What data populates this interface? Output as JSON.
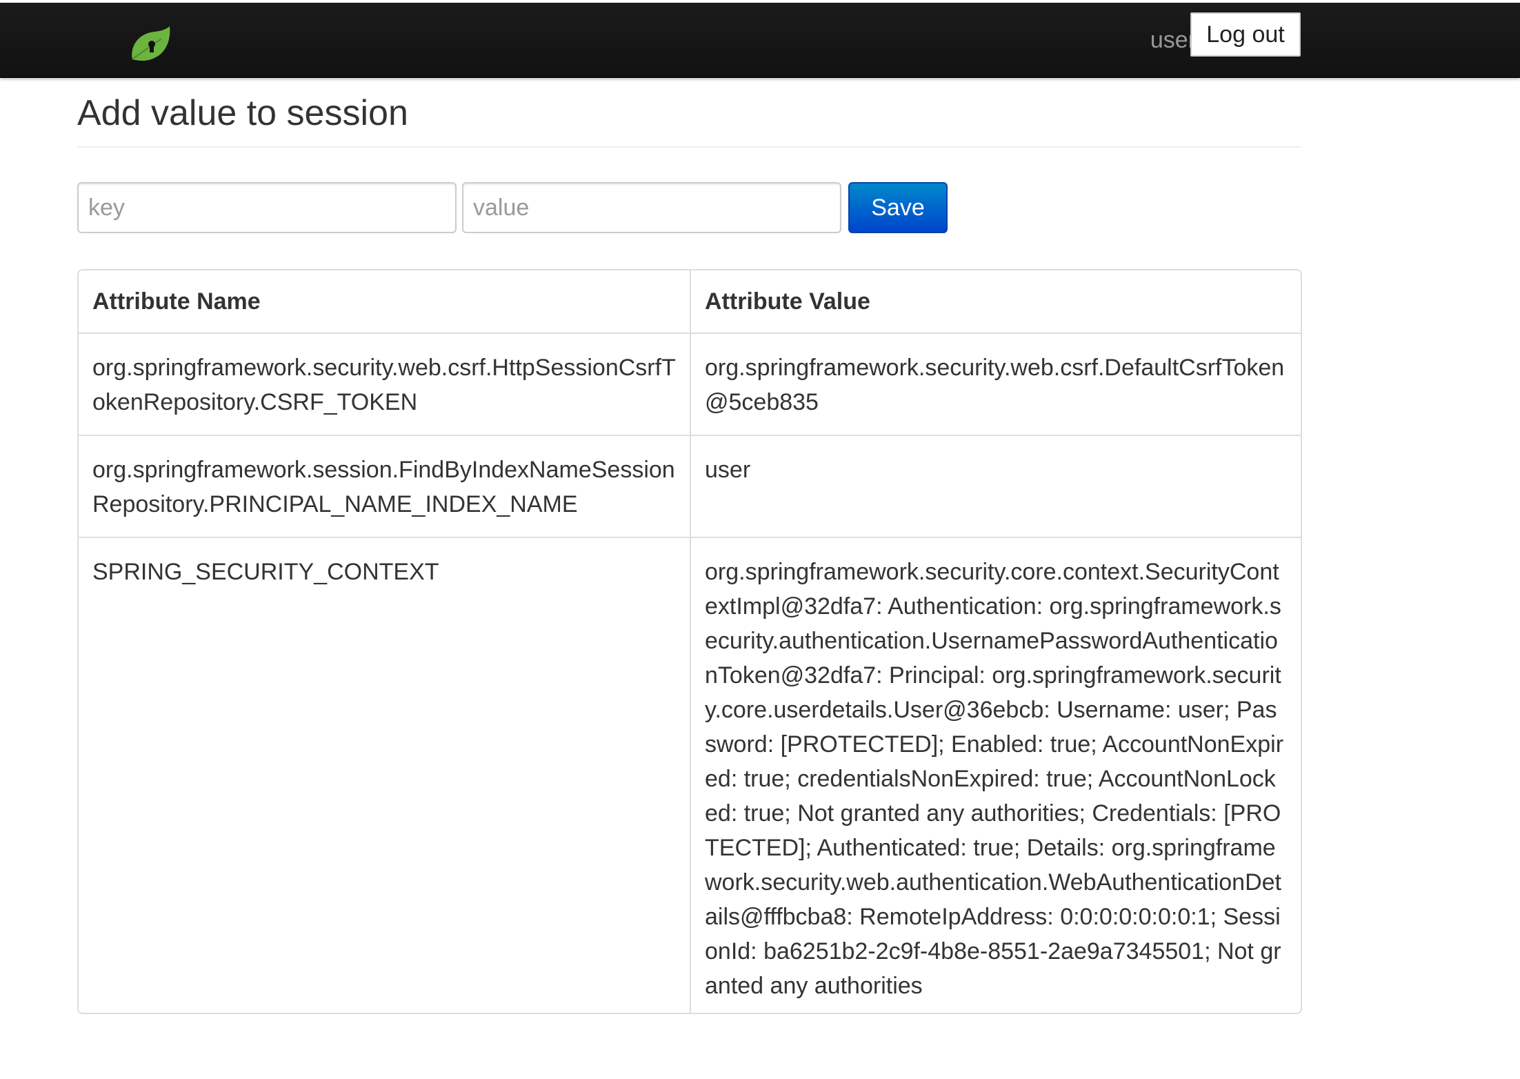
{
  "navbar": {
    "logo_icon": "spring-leaf-keyhole-icon",
    "username": "user",
    "logout_label": "Log out"
  },
  "main": {
    "title": "Add value to session",
    "form": {
      "key_placeholder": "key",
      "value_placeholder": "value",
      "save_label": "Save"
    },
    "table": {
      "headers": [
        "Attribute Name",
        "Attribute Value"
      ],
      "rows": [
        {
          "name": "org.springframework.security.web.csrf.HttpSessionCsrfTokenRepository.CSRF_TOKEN",
          "value": "org.springframework.security.web.csrf.DefaultCsrfToken@5ceb835"
        },
        {
          "name": "org.springframework.session.FindByIndexNameSessionRepository.PRINCIPAL_NAME_INDEX_NAME",
          "value": "user"
        },
        {
          "name": "SPRING_SECURITY_CONTEXT",
          "value": "org.springframework.security.core.context.SecurityContextImpl@32dfa7: Authentication: org.springframework.security.authentication.UsernamePasswordAuthenticationToken@32dfa7: Principal: org.springframework.security.core.userdetails.User@36ebcb: Username: user; Password: [PROTECTED]; Enabled: true; AccountNonExpired: true; credentialsNonExpired: true; AccountNonLocked: true; Not granted any authorities; Credentials: [PROTECTED]; Authenticated: true; Details: org.springframework.security.web.authentication.WebAuthenticationDetails@fffbcba8: RemoteIpAddress: 0:0:0:0:0:0:0:1; SessionId: ba6251b2-2c9f-4b8e-8551-2ae9a7345501; Not granted any authorities"
        }
      ]
    }
  },
  "colors": {
    "navbar_bg": "#1b1b1b",
    "primary_button": "#0055cc",
    "leaf_green": "#6db33f",
    "border": "#dddddd"
  }
}
